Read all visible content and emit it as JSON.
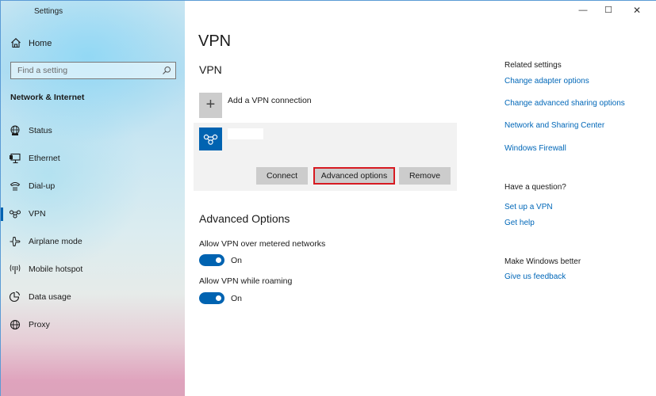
{
  "window": {
    "app_title": "Settings",
    "controls": {
      "minimize": "—",
      "maximize": "☐",
      "close": "✕"
    }
  },
  "sidebar": {
    "back_glyph": "←",
    "home_label": "Home",
    "search_placeholder": "Find a setting",
    "section_title": "Network & Internet",
    "items": [
      {
        "label": "Status",
        "icon": "globe-status-icon",
        "active": false
      },
      {
        "label": "Ethernet",
        "icon": "ethernet-icon",
        "active": false
      },
      {
        "label": "Dial-up",
        "icon": "dialup-icon",
        "active": false
      },
      {
        "label": "VPN",
        "icon": "vpn-icon",
        "active": true
      },
      {
        "label": "Airplane mode",
        "icon": "airplane-icon",
        "active": false
      },
      {
        "label": "Mobile hotspot",
        "icon": "hotspot-icon",
        "active": false
      },
      {
        "label": "Data usage",
        "icon": "data-usage-icon",
        "active": false
      },
      {
        "label": "Proxy",
        "icon": "proxy-globe-icon",
        "active": false
      }
    ]
  },
  "main": {
    "page_title": "VPN",
    "group_title": "VPN",
    "add_vpn": {
      "icon_glyph": "+",
      "label": "Add a VPN connection"
    },
    "vpn_connection": {
      "name": "",
      "buttons": {
        "connect": "Connect",
        "advanced": "Advanced options",
        "remove": "Remove"
      }
    },
    "advanced_options": {
      "title": "Advanced Options",
      "options": [
        {
          "label": "Allow VPN over metered networks",
          "state": "On",
          "enabled": true
        },
        {
          "label": "Allow VPN while roaming",
          "state": "On",
          "enabled": true
        }
      ]
    }
  },
  "related": {
    "related_settings": {
      "heading": "Related settings",
      "links": [
        "Change adapter options",
        "Change advanced sharing options",
        "Network and Sharing Center",
        "Windows Firewall"
      ]
    },
    "question": {
      "heading": "Have a question?",
      "links": [
        "Set up a VPN",
        "Get help"
      ]
    },
    "feedback": {
      "heading": "Make Windows better",
      "links": [
        "Give us feedback"
      ]
    }
  },
  "colors": {
    "accent": "#0063b1",
    "link": "#0067b8",
    "highlight_border": "#d71a21",
    "button_bg": "#cccccc",
    "card_bg": "#f2f2f2"
  }
}
